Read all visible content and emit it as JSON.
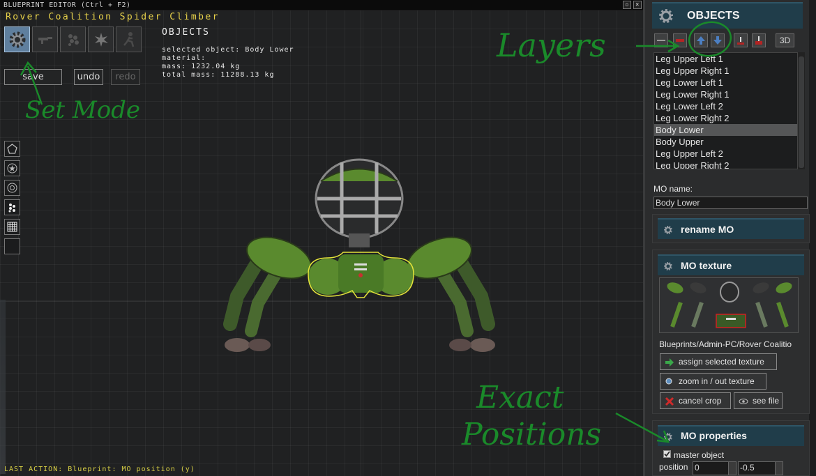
{
  "editor": {
    "title": "BLUEPRINT EDITOR (Ctrl + F2)",
    "blueprint_name": "Rover Coalition Spider Climber",
    "mode_buttons": [
      {
        "name": "gear-mode",
        "active": true
      },
      {
        "name": "weapon-mode",
        "active": false
      },
      {
        "name": "particle-mode",
        "active": false
      },
      {
        "name": "explosion-mode",
        "active": false
      },
      {
        "name": "character-mode",
        "active": false
      }
    ],
    "save_label": "save",
    "undo_label": "undo",
    "redo_label": "redo",
    "info": {
      "heading": "OBJECTS",
      "selected": "selected object: Body Lower",
      "material": "material:",
      "mass": "mass: 1232.04 kg",
      "total_mass": "total mass: 11288.13 kg"
    },
    "tools": [
      "pentagon-icon",
      "star-circle-icon",
      "target-icon",
      "particles-icon",
      "grid-icon",
      "blank-icon"
    ],
    "last_action": "LAST ACTION: Blueprint: MO position (y)"
  },
  "annotations": {
    "set_mode": "Set Mode",
    "layers": "Layers",
    "exact_line1": "Exact",
    "exact_line2": "Positions"
  },
  "panel": {
    "header": "OBJECTS",
    "layer_buttons": [
      "minus",
      "remove",
      "layer-up",
      "layer-down",
      "move-down",
      "move-up"
    ],
    "button_3d": "3D",
    "objects": [
      "Leg Upper Left 1",
      "Leg Upper Right 1",
      "Leg Lower Left 1",
      "Leg Lower Right 1",
      "Leg Lower Left 2",
      "Leg Lower Right 2",
      "Body Lower",
      "Body Upper",
      "Leg Upper Left 2",
      "Leg Upper Right 2"
    ],
    "selected_object": "Body Lower",
    "mo_name_label": "MO name:",
    "mo_name_value": "Body Lower",
    "rename_header": "rename MO",
    "texture_header": "MO texture",
    "texture_path": "Blueprints/Admin-PC/Rover Coalitio",
    "assign_label": "assign selected texture",
    "zoom_label": "zoom in / out texture",
    "cancel_crop_label": "cancel crop",
    "see_file_label": "see file",
    "properties_header": "MO properties",
    "master_object_label": "master object",
    "master_object_checked": true,
    "position_label": "position",
    "position_x": "0",
    "position_y": "-0.5"
  }
}
